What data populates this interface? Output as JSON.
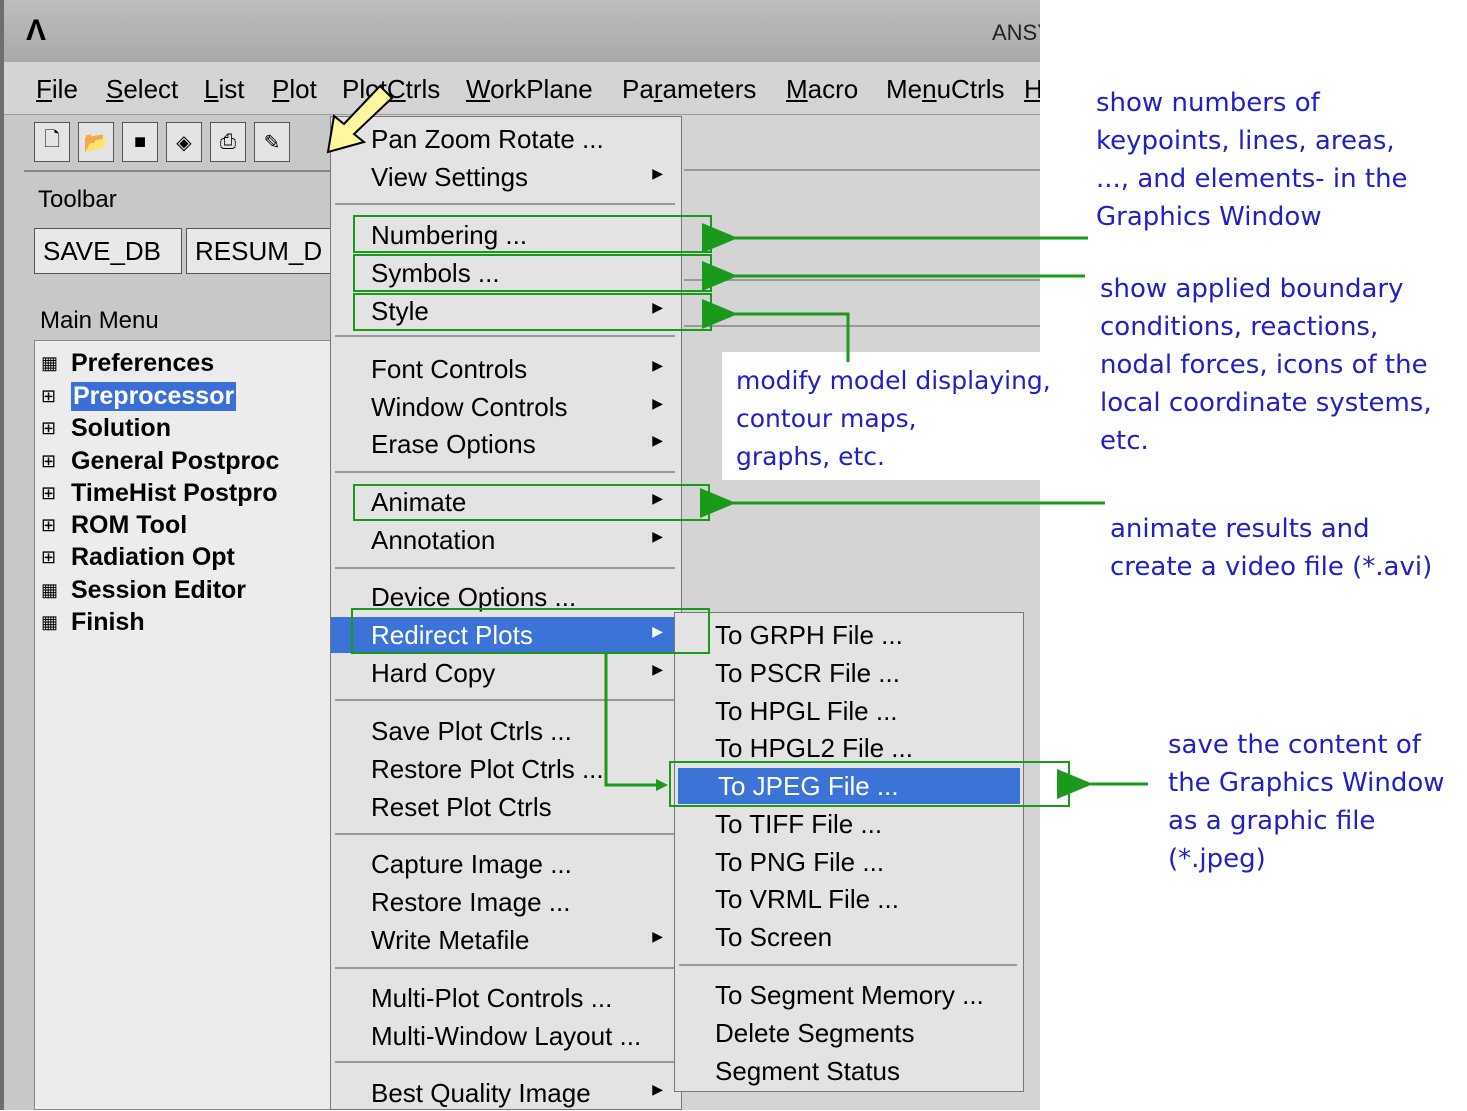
{
  "window": {
    "logo": "Λ",
    "title": "ANSY"
  },
  "menubar": {
    "items": [
      {
        "pre": "",
        "u": "F",
        "post": "ile"
      },
      {
        "pre": "",
        "u": "S",
        "post": "elect"
      },
      {
        "pre": "",
        "u": "L",
        "post": "ist"
      },
      {
        "pre": "",
        "u": "P",
        "post": "lot"
      },
      {
        "pre": "Plot",
        "u": "C",
        "post": "trls"
      },
      {
        "pre": "",
        "u": "W",
        "post": "orkPlane"
      },
      {
        "pre": "Pa",
        "u": "r",
        "post": "ameters"
      },
      {
        "pre": "",
        "u": "M",
        "post": "acro"
      },
      {
        "pre": "Me",
        "u": "n",
        "post": "uCtrls"
      },
      {
        "pre": "",
        "u": "H",
        "post": ""
      }
    ]
  },
  "toolbar": {
    "label": "Toolbar",
    "buttons": [
      "SAVE_DB",
      "RESUM_D"
    ],
    "icons": [
      "new-file-icon",
      "open-folder-icon",
      "save-icon",
      "cube-icon",
      "print-icon",
      "report-icon"
    ]
  },
  "main_menu": {
    "label": "Main Menu",
    "items": [
      {
        "glyph": "▦",
        "label": "Preferences"
      },
      {
        "glyph": "⊞",
        "label": "Preprocessor"
      },
      {
        "glyph": "⊞",
        "label": "Solution"
      },
      {
        "glyph": "⊞",
        "label": "General Postproc"
      },
      {
        "glyph": "⊞",
        "label": "TimeHist Postpro"
      },
      {
        "glyph": "⊞",
        "label": "ROM Tool"
      },
      {
        "glyph": "⊞",
        "label": "Radiation Opt"
      },
      {
        "glyph": "▦",
        "label": "Session Editor"
      },
      {
        "glyph": "▦",
        "label": "Finish"
      }
    ]
  },
  "plotctrls_menu": {
    "items": [
      {
        "label": "Pan Zoom Rotate ...",
        "submenu": false
      },
      {
        "label": "View Settings",
        "submenu": true
      },
      {
        "label": "Numbering ...",
        "submenu": false
      },
      {
        "label": "Symbols ...",
        "submenu": false
      },
      {
        "label": "Style",
        "submenu": true
      },
      {
        "label": "Font Controls",
        "submenu": true
      },
      {
        "label": "Window Controls",
        "submenu": true
      },
      {
        "label": "Erase Options",
        "submenu": true
      },
      {
        "label": "Animate",
        "submenu": true
      },
      {
        "label": "Annotation",
        "submenu": true
      },
      {
        "label": "Device Options ...",
        "submenu": false
      },
      {
        "label": "Redirect Plots",
        "submenu": true
      },
      {
        "label": "Hard Copy",
        "submenu": true
      },
      {
        "label": "Save Plot Ctrls ...",
        "submenu": false
      },
      {
        "label": "Restore Plot Ctrls ...",
        "submenu": false
      },
      {
        "label": "Reset Plot Ctrls",
        "submenu": false
      },
      {
        "label": "Capture Image ...",
        "submenu": false
      },
      {
        "label": "Restore Image ...",
        "submenu": false
      },
      {
        "label": "Write Metafile",
        "submenu": true
      },
      {
        "label": "Multi-Plot Controls ...",
        "submenu": false
      },
      {
        "label": "Multi-Window Layout ...",
        "submenu": false
      },
      {
        "label": "Best Quality Image",
        "submenu": true
      }
    ]
  },
  "redirect_submenu": {
    "items": [
      "To GRPH File ...",
      "To PSCR File ...",
      "To HPGL File ...",
      "To HPGL2 File ...",
      "To JPEG File ...",
      "To TIFF File ...",
      "To PNG File ...",
      "To VRML File ...",
      "To Screen",
      "To Segment Memory ...",
      "Delete Segments",
      "Segment Status"
    ]
  },
  "annotations": {
    "numbering": [
      "show numbers of",
      "keypoints, lines, areas,",
      "..., and elements- in the",
      "Graphics Window"
    ],
    "symbols": [
      "show applied boundary",
      "conditions, reactions,",
      "nodal forces,  icons of the",
      "local coordinate systems,",
      "etc."
    ],
    "style": [
      "modify model displaying,",
      "contour maps,",
      "graphs, etc."
    ],
    "animate": [
      "animate results and",
      "create a video file (*.avi)"
    ],
    "jpeg": [
      "save the content of",
      "the Graphics Window",
      "as a graphic file",
      "(*.jpeg)"
    ]
  },
  "colors": {
    "highlight": "#3b73d6",
    "annotation_box": "#1a9a1a",
    "annotation_text": "#2020c8"
  }
}
